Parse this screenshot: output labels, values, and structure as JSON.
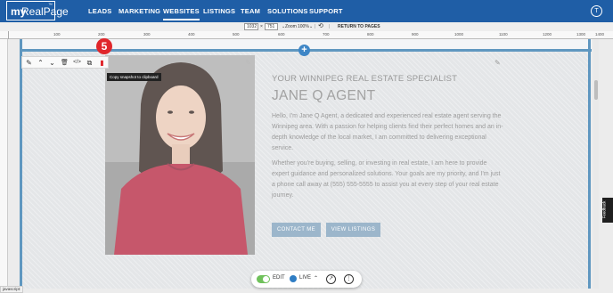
{
  "brand": {
    "logo_my": "my",
    "logo_name": "RealPage",
    "logo_tm": "™"
  },
  "nav": {
    "items": [
      {
        "label": "LEADS",
        "active": false
      },
      {
        "label": "MARKETING",
        "active": false
      },
      {
        "label": "WEBSITES",
        "active": true
      },
      {
        "label": "LISTINGS",
        "active": false
      },
      {
        "label": "TEAM",
        "active": false
      },
      {
        "label": "SOLUTIONS",
        "active": false
      },
      {
        "label": "SUPPORT",
        "active": false
      }
    ],
    "user_initial": "T"
  },
  "editbar": {
    "width_value": "1032",
    "height_value": "751",
    "zoom_label": "Zoom",
    "zoom_value": "100%",
    "return_label": "RETURN TO PAGES"
  },
  "ruler": {
    "labels": [
      "100",
      "200",
      "300",
      "400",
      "500",
      "600",
      "700",
      "800",
      "900",
      "1000",
      "1100",
      "1200",
      "1300",
      "1400"
    ]
  },
  "element_toolbar": {
    "icons": [
      "pencil-icon",
      "chevron-up-icon",
      "chevron-down-icon",
      "trash-icon",
      "code-icon",
      "duplicate-icon",
      "copy-snapshot-icon"
    ],
    "tooltip": "Copy snapshot to clipboard",
    "step_badge": "5"
  },
  "agent": {
    "subtitle": "YOUR WINNIPEG REAL ESTATE SPECIALIST",
    "name": "JANE Q AGENT",
    "para1": "Hello, I'm Jane Q Agent, a dedicated and experienced real estate agent serving the Winnipeg area. With a passion for helping clients find their perfect homes and an in-depth knowledge of the local market, I am committed to delivering exceptional service.",
    "para2": "Whether you're buying, selling, or investing in real estate, I am here to provide expert guidance and personalized solutions. Your goals are my priority, and I'm just a phone call away at (555) 555-5555 to assist you at every step of your real estate journey.",
    "btn_contact": "CONTACT ME",
    "btn_listings": "VIEW LISTINGS"
  },
  "dock": {
    "edit_label": "EDIT",
    "live_label": "LIVE"
  },
  "feedback_label": "Feedback",
  "status_text": "javascript:",
  "colors": {
    "nav_bg": "#1f5ea6",
    "accent": "#3e86c6",
    "badge": "#e0262b",
    "button": "#9cb6cb"
  }
}
